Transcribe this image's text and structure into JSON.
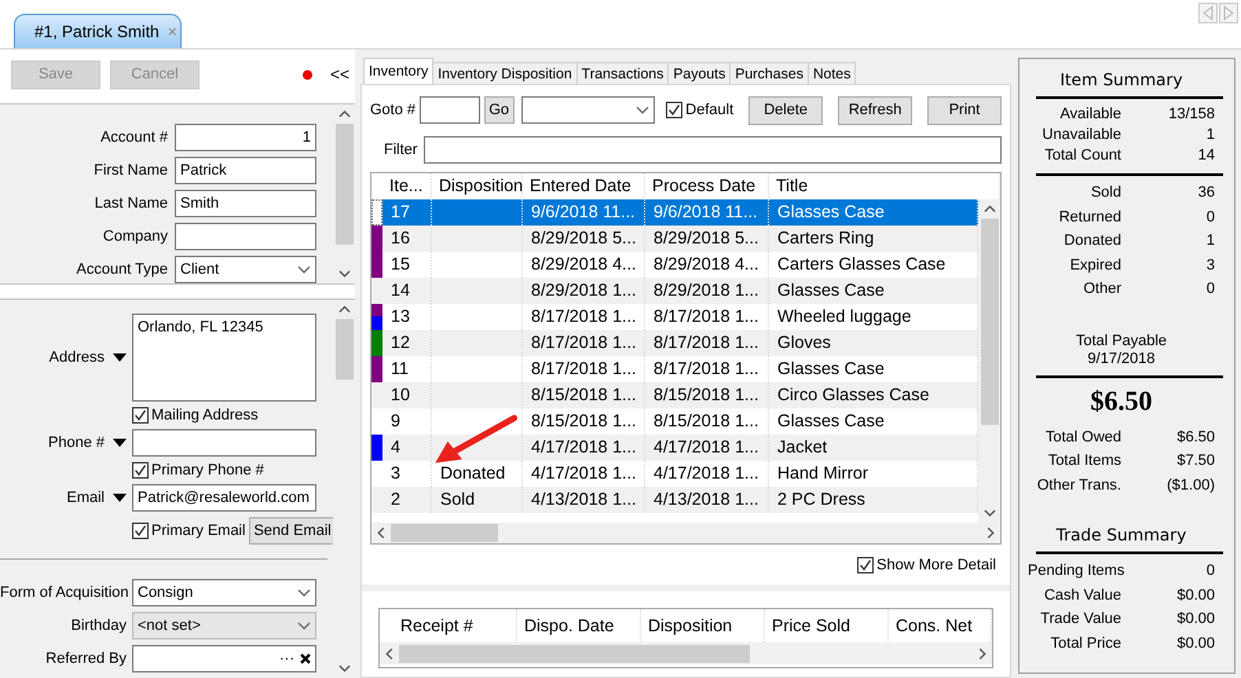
{
  "record_tab": {
    "label": "#1, Patrick Smith",
    "close": "×",
    "selected": true
  },
  "actions": [
    {
      "label": "Save",
      "disabled": true
    },
    {
      "label": "Cancel",
      "disabled": true
    }
  ],
  "collapse": "<<",
  "unsaved": true,
  "account": [
    {
      "kind": "number",
      "label": "Account #",
      "value": "1"
    },
    {
      "kind": "text",
      "label": "First Name",
      "value": "Patrick"
    },
    {
      "kind": "text",
      "label": "Last Name",
      "value": "Smith"
    },
    {
      "kind": "text",
      "label": "Company"
    },
    {
      "kind": "select",
      "label": "Account Type",
      "value": "Client"
    }
  ],
  "contact": [
    {
      "kind": "multiline",
      "label": "Address",
      "value": "Orlando, FL  12345"
    },
    {
      "kind": "checkbox",
      "label": "Mailing Address",
      "checked": true
    },
    {
      "kind": "text",
      "label": "Phone #"
    },
    {
      "kind": "checkbox",
      "label": "Primary Phone #",
      "checked": true
    },
    {
      "kind": "text",
      "label": "Email",
      "value": "Patrick@resaleworld.com"
    },
    {
      "kind": "checkbox",
      "label": "Primary Email",
      "checked": true,
      "button": "Send Email"
    }
  ],
  "profile": [
    {
      "kind": "select",
      "label": "Form of Acquisition",
      "value": "Consign",
      "disabled": false
    },
    {
      "kind": "select",
      "label": "Birthday",
      "value": "<not set>",
      "disabled": true
    },
    {
      "kind": "lookup",
      "label": "Referred By",
      "browse": "···"
    }
  ],
  "tabs": [
    {
      "label": "Inventory",
      "selected": true
    },
    {
      "label": "Inventory Disposition",
      "selected": false
    },
    {
      "label": "Transactions",
      "selected": false
    },
    {
      "label": "Payouts",
      "selected": false
    },
    {
      "label": "Purchases",
      "selected": false
    },
    {
      "label": "Notes",
      "selected": false
    }
  ],
  "toolbar": {
    "goto_label": "Goto #",
    "go": "Go",
    "default_label": "Default",
    "default_checked": true,
    "buttons": [
      "Delete",
      "Refresh",
      "Print"
    ],
    "filter_label": "Filter"
  },
  "inventory": {
    "columns": [
      "Ite...",
      "Disposition",
      "Entered Date",
      "Process Date",
      "Title"
    ],
    "rows": [
      {
        "selected": true,
        "cells": [
          "17",
          "",
          "9/6/2018 11...",
          "9/6/2018 11...",
          "Glasses Case"
        ]
      },
      {
        "selected": false,
        "markers": [
          {
            "color": "#800080"
          }
        ],
        "cells": [
          "16",
          "",
          "8/29/2018 5...",
          "8/29/2018 5...",
          "Carters Ring"
        ]
      },
      {
        "selected": false,
        "markers": [
          {
            "color": "#800080"
          }
        ],
        "cells": [
          "15",
          "",
          "8/29/2018 4...",
          "8/29/2018 4...",
          "Carters Glasses Case"
        ]
      },
      {
        "selected": false,
        "cells": [
          "14",
          "",
          "8/29/2018 1...",
          "8/29/2018 1...",
          "Glasses Case"
        ]
      },
      {
        "selected": false,
        "markers": [
          {
            "color": "#800080"
          },
          {
            "color": "#0000ff"
          }
        ],
        "cells": [
          "13",
          "",
          "8/17/2018 1...",
          "8/17/2018 1...",
          "Wheeled luggage"
        ]
      },
      {
        "selected": false,
        "markers": [
          {
            "color": "#008000"
          }
        ],
        "cells": [
          "12",
          "",
          "8/17/2018 1...",
          "8/17/2018 1...",
          "Gloves"
        ]
      },
      {
        "selected": false,
        "markers": [
          {
            "color": "#800080"
          }
        ],
        "cells": [
          "11",
          "",
          "8/17/2018 1...",
          "8/17/2018 1...",
          "Glasses Case"
        ]
      },
      {
        "selected": false,
        "cells": [
          "10",
          "",
          "8/15/2018 1...",
          "8/15/2018 1...",
          "Circo Glasses Case"
        ]
      },
      {
        "selected": false,
        "cells": [
          "9",
          "",
          "8/15/2018 1...",
          "8/15/2018 1...",
          "Glasses Case"
        ]
      },
      {
        "selected": false,
        "markers": [
          {
            "color": "#0000ff"
          }
        ],
        "cells": [
          "4",
          "",
          "4/17/2018 1...",
          "4/17/2018 1...",
          "Jacket"
        ]
      },
      {
        "selected": false,
        "cells": [
          "3",
          "Donated",
          "4/17/2018 1...",
          "4/17/2018 1...",
          "Hand Mirror"
        ]
      },
      {
        "selected": false,
        "cells": [
          "2",
          "Sold",
          "4/13/2018 1...",
          "4/13/2018 1...",
          "2 PC Dress"
        ]
      }
    ]
  },
  "show_more_detail": {
    "label": "Show More Detail",
    "checked": true
  },
  "detail_table": {
    "columns": [
      "Receipt #",
      "Dispo. Date",
      "Disposition",
      "Price Sold",
      "Cons. Net"
    ]
  },
  "item_summary": {
    "title": "Item Summary",
    "groups": [
      [
        {
          "label": "Available",
          "value": "13/158"
        },
        {
          "label": "Unavailable",
          "value": "1"
        },
        {
          "label": "Total Count",
          "value": "14"
        }
      ],
      [
        {
          "label": "Sold",
          "value": "36"
        },
        {
          "label": "Returned",
          "value": "0"
        },
        {
          "label": "Donated",
          "value": "1"
        },
        {
          "label": "Expired",
          "value": "3"
        },
        {
          "label": "Other",
          "value": "0"
        }
      ]
    ]
  },
  "total_payable": {
    "label": "Total Payable",
    "date": "9/17/2018",
    "amount": "$6.50",
    "rows": [
      {
        "label": "Total Owed",
        "value": "$6.50"
      },
      {
        "label": "Total Items",
        "value": "$7.50"
      },
      {
        "label": "Other Trans.",
        "value": "($1.00)"
      }
    ]
  },
  "trade_summary": {
    "title": "Trade Summary",
    "rows": [
      {
        "label": "Pending Items",
        "value": "0"
      },
      {
        "label": "Cash Value",
        "value": "$0.00"
      },
      {
        "label": "Trade Value",
        "value": "$0.00"
      },
      {
        "label": "Total Price",
        "value": "$0.00"
      }
    ]
  }
}
